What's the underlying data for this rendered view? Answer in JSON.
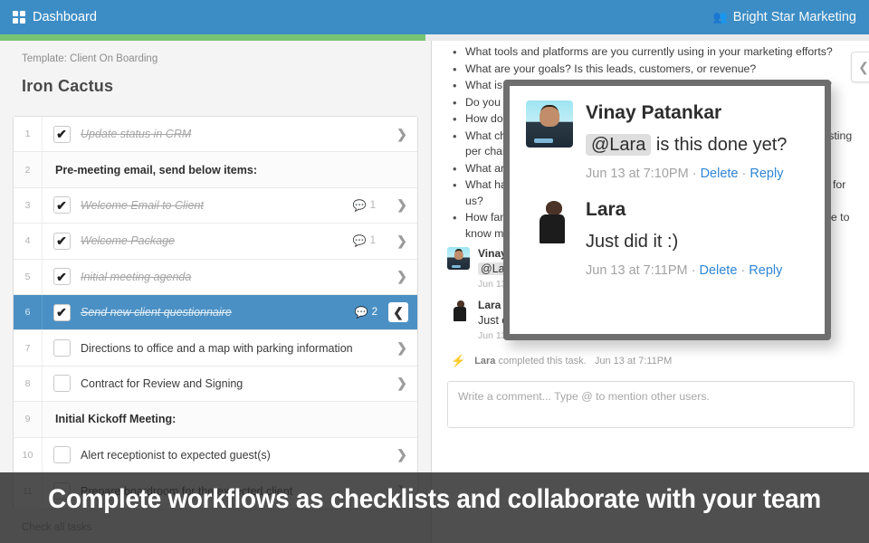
{
  "topbar": {
    "brand_label": "Dashboard",
    "brand_icon": "grid-icon",
    "org_label": "Bright Star Marketing",
    "org_icon": "people-icon",
    "background_color": "#3c8dc5"
  },
  "progress": {
    "fill_color": "#76c473",
    "percent": 49
  },
  "left_panel": {
    "template_line": "Template: Client On Boarding",
    "project_title": "Iron Cactus",
    "check_all_label": "Check all tasks",
    "tasks": [
      {
        "num": "1",
        "label": "Update status in CRM",
        "done": true,
        "heading": false,
        "comments": "",
        "arrow": "❯"
      },
      {
        "num": "2",
        "label": "Pre-meeting email, send below items:",
        "done": false,
        "heading": true,
        "comments": "",
        "arrow": ""
      },
      {
        "num": "3",
        "label": "Welcome Email to Client",
        "done": true,
        "heading": false,
        "comments": "1",
        "arrow": "❯"
      },
      {
        "num": "4",
        "label": "Welcome Package",
        "done": true,
        "heading": false,
        "comments": "1",
        "arrow": "❯"
      },
      {
        "num": "5",
        "label": "Initial meeting agenda",
        "done": true,
        "heading": false,
        "comments": "",
        "arrow": "❯"
      },
      {
        "num": "6",
        "label": "Send new client questionnaire",
        "done": true,
        "heading": false,
        "comments": "2",
        "arrow": "❮",
        "selected": true
      },
      {
        "num": "7",
        "label": "Directions to office and a map with parking information",
        "done": false,
        "heading": false,
        "comments": "",
        "arrow": "❯"
      },
      {
        "num": "8",
        "label": "Contract for Review and Signing",
        "done": false,
        "heading": false,
        "comments": "",
        "arrow": "❯"
      },
      {
        "num": "9",
        "label": "Initial Kickoff Meeting:",
        "done": false,
        "heading": true,
        "comments": "",
        "arrow": ""
      },
      {
        "num": "10",
        "label": "Alert receptionist to expected guest(s)",
        "done": false,
        "heading": false,
        "comments": "",
        "arrow": "❯"
      },
      {
        "num": "11",
        "label": "Prepare boardroom for the expected client",
        "done": false,
        "heading": false,
        "comments": "",
        "arrow": "❯"
      }
    ]
  },
  "right_panel": {
    "collapse_icon": "❮",
    "questions": [
      "What tools and platforms are you currently using in your marketing efforts?",
      "What are your goals? Is this leads, customers, or revenue?",
      "What is the lifetime value (LTV) of each customer? What is your LTV goal?",
      "Do you currently have a sales funnel in place? What does it look like?",
      "How do you currently track and measure your marketing results?",
      "What channels are you currently investing in? What are you currently investing per channel?",
      "What are your current customer acquisition methods?",
      "What has worked well for you in the past? What expectations do you have for us?",
      "How familiar with online marketing is your team? What areas would you like to know more about? Do you want to be trained?"
    ],
    "comments": [
      {
        "author": "Vinay Patankar",
        "avatar": "vinay-avatar",
        "mention": "@Lara",
        "text": " is this done yet?",
        "time": "Jun 13 at 7:10PM",
        "delete_label": "Delete",
        "reply_label": "Reply"
      },
      {
        "author": "Lara",
        "avatar": "lara-avatar",
        "mention": "",
        "text": "Just did it :)",
        "time": "Jun 13 at 7:11PM",
        "delete_label": "Delete",
        "reply_label": "Reply"
      }
    ],
    "activity": {
      "icon": "bolt-icon",
      "actor": "Lara",
      "text": "completed this task.",
      "time": "Jun 13 at 7:11PM"
    },
    "comment_box_placeholder": "Write a comment... Type @ to mention other users."
  },
  "popup": {
    "comments": [
      {
        "author": "Vinay Patankar",
        "avatar": "vinay-avatar",
        "mention": "@Lara",
        "text": " is this done yet?",
        "time": "Jun 13 at 7:10PM",
        "delete_label": "Delete",
        "reply_label": "Reply"
      },
      {
        "author": "Lara",
        "avatar": "lara-avatar",
        "mention": "",
        "text": "Just did it :)",
        "time": "Jun 13 at 7:11PM",
        "delete_label": "Delete",
        "reply_label": "Reply"
      }
    ]
  },
  "caption": {
    "text": "Complete workflows as checklists and collaborate with your team"
  }
}
